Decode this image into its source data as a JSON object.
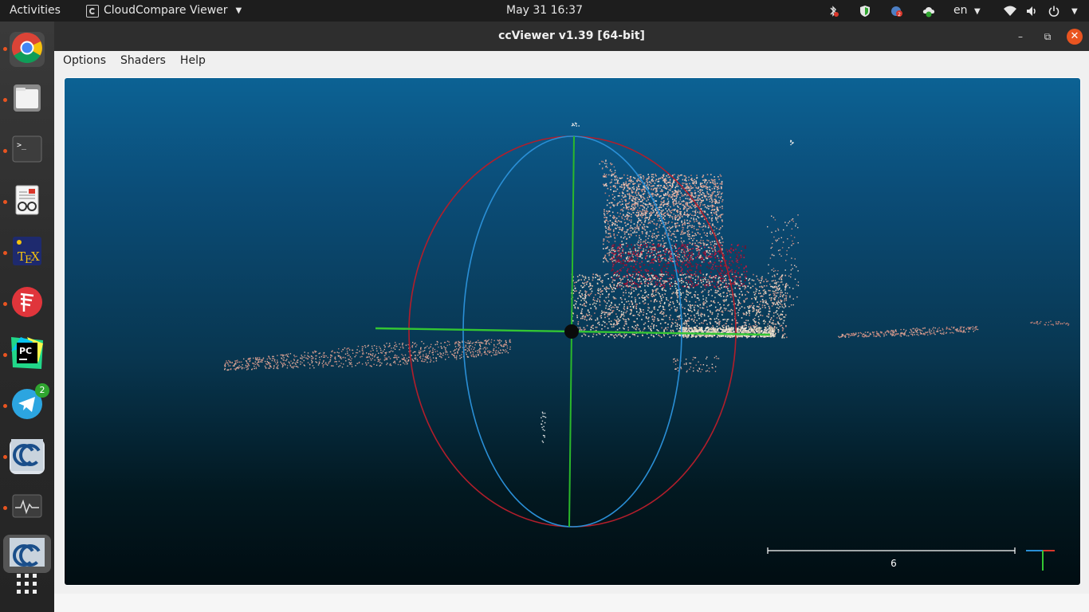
{
  "topbar": {
    "activities": "Activities",
    "app_name": "CloudCompare Viewer",
    "clock": "May 31  16:37",
    "language": "en",
    "tray_icons": [
      "bluetooth-icon",
      "shield-icon",
      "notification-icon",
      "cloud-sync-icon",
      "wifi-icon",
      "volume-icon",
      "power-icon"
    ]
  },
  "dock": {
    "items": [
      {
        "name": "chrome",
        "icon": "chrome-icon"
      },
      {
        "name": "files",
        "icon": "folder-icon"
      },
      {
        "name": "terminal",
        "icon": "terminal-icon"
      },
      {
        "name": "document-viewer",
        "icon": "document-viewer-icon"
      },
      {
        "name": "texmaker",
        "icon": "tex-icon"
      },
      {
        "name": "app-red",
        "icon": "red-app-icon"
      },
      {
        "name": "pycharm",
        "icon": "pycharm-icon",
        "label": "PC"
      },
      {
        "name": "telegram",
        "icon": "telegram-icon",
        "badge": "2"
      },
      {
        "name": "cloudcompare",
        "icon": "cloudcompare-icon"
      },
      {
        "name": "system-monitor",
        "icon": "system-monitor-icon"
      },
      {
        "name": "ccviewer",
        "icon": "ccviewer-icon"
      },
      {
        "name": "show-apps",
        "icon": "app-grid-icon"
      }
    ]
  },
  "window": {
    "title": "ccViewer v1.39 [64-bit]",
    "menu": [
      "Options",
      "Shaders",
      "Help"
    ],
    "scale_value": "6"
  },
  "colors": {
    "accent": "#e95420",
    "sphere_red": "#b21e2b",
    "sphere_blue": "#2a8fd6",
    "axis_green": "#33c633"
  }
}
